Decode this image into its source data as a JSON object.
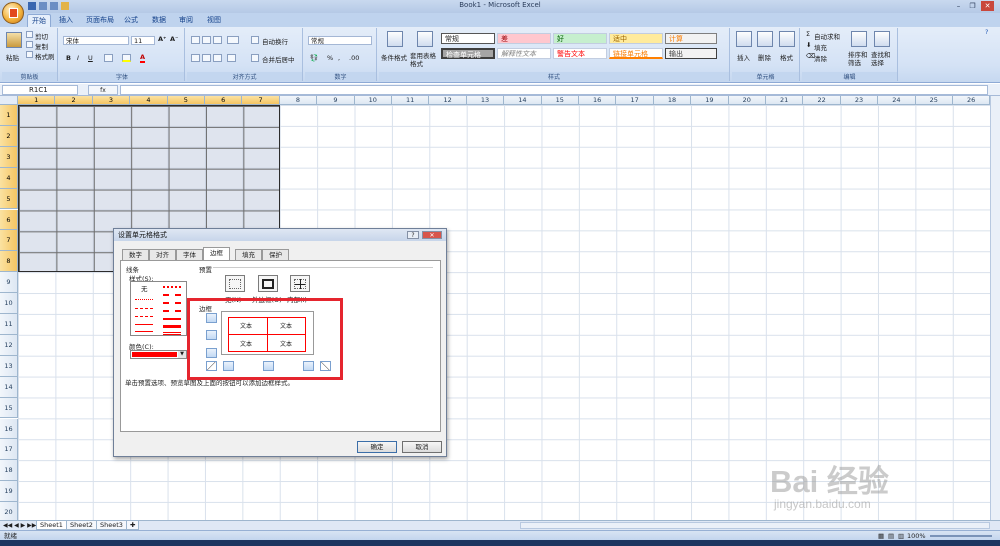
{
  "app": {
    "title": "Book1 - Microsoft Excel"
  },
  "tabs": [
    "开始",
    "插入",
    "页面布局",
    "公式",
    "数据",
    "审阅",
    "视图"
  ],
  "ribbon": {
    "clipboard": {
      "cut": "剪切",
      "copy": "复制",
      "paste": "粘贴",
      "format_painter": "格式刷",
      "label": "剪贴板"
    },
    "font": {
      "font_name": "宋体",
      "font_size": "11",
      "label": "字体"
    },
    "alignment": {
      "wrap_text": "自动换行",
      "merge_center": "合并后居中",
      "label": "对齐方式"
    },
    "number": {
      "format": "常规",
      "label": "数字"
    },
    "styles": {
      "conditional_format": "条件格式",
      "format_as_table": "套用表格格式",
      "cells": [
        {
          "text": "常规",
          "bg": "#ffffff",
          "color": "#000000"
        },
        {
          "text": "差",
          "bg": "#ffc7ce",
          "color": "#9c0006"
        },
        {
          "text": "好",
          "bg": "#c6efce",
          "color": "#006100"
        },
        {
          "text": "适中",
          "bg": "#ffeb9c",
          "color": "#9c6500"
        },
        {
          "text": "计算",
          "bg": "#f2f2f2",
          "color": "#fa7d00"
        },
        {
          "text": "检查单元格",
          "bg": "#a5a5a5",
          "color": "#ffffff"
        },
        {
          "text": "解释性文本",
          "bg": "#ffffff",
          "color": "#7f7f7f"
        },
        {
          "text": "警告文本",
          "bg": "#ffffff",
          "color": "#ff0000"
        },
        {
          "text": "链接单元格",
          "bg": "#ffffff",
          "color": "#fa7d00"
        },
        {
          "text": "输出",
          "bg": "#f2f2f2",
          "color": "#3f3f3f"
        }
      ],
      "label": "样式"
    },
    "cells_group": {
      "insert": "插入",
      "delete": "删除",
      "format": "格式",
      "label": "单元格"
    },
    "editing": {
      "autosum": "自动求和",
      "fill": "填充",
      "clear": "清除",
      "sort_filter": "排序和筛选",
      "find_select": "查找和选择",
      "label": "编辑"
    }
  },
  "formula_bar": {
    "name_box": "R1C1",
    "fx": "fx"
  },
  "sheet": {
    "columns": [
      "1",
      "2",
      "3",
      "4",
      "5",
      "6",
      "7",
      "8",
      "9",
      "10",
      "11",
      "12",
      "13",
      "14",
      "15",
      "16",
      "17",
      "18",
      "19",
      "20",
      "21",
      "22",
      "23",
      "24",
      "25",
      "26"
    ],
    "rows": [
      "1",
      "2",
      "3",
      "4",
      "5",
      "6",
      "7",
      "8",
      "9",
      "10",
      "11",
      "12",
      "13",
      "14",
      "15",
      "16",
      "17",
      "18",
      "19",
      "20"
    ],
    "selected_cols": 7,
    "selected_rows": 8
  },
  "sheet_tabs": [
    "Sheet1",
    "Sheet2",
    "Sheet3"
  ],
  "status": {
    "ready": "就绪",
    "zoom": "100%"
  },
  "dialog": {
    "title": "设置单元格格式",
    "tabs": [
      "数字",
      "对齐",
      "字体",
      "边框",
      "填充",
      "保护"
    ],
    "active_tab": "边框",
    "line_label": "线条",
    "style_label": "样式(S):",
    "none_label": "无",
    "color_label": "颜色(C):",
    "color_value": "#ff0000",
    "presets_label": "预置",
    "presets": [
      "无(N)",
      "外边框(O)",
      "内部(I)"
    ],
    "border_label": "边框",
    "preview_text": [
      "文本",
      "文本",
      "文本",
      "文本"
    ],
    "hint": "单击预置选项、预览草图及上面的按钮可以添加边框样式。",
    "ok": "确定",
    "cancel": "取消"
  },
  "watermark": {
    "logo": "Bai 经验",
    "url": "jingyan.baidu.com"
  }
}
